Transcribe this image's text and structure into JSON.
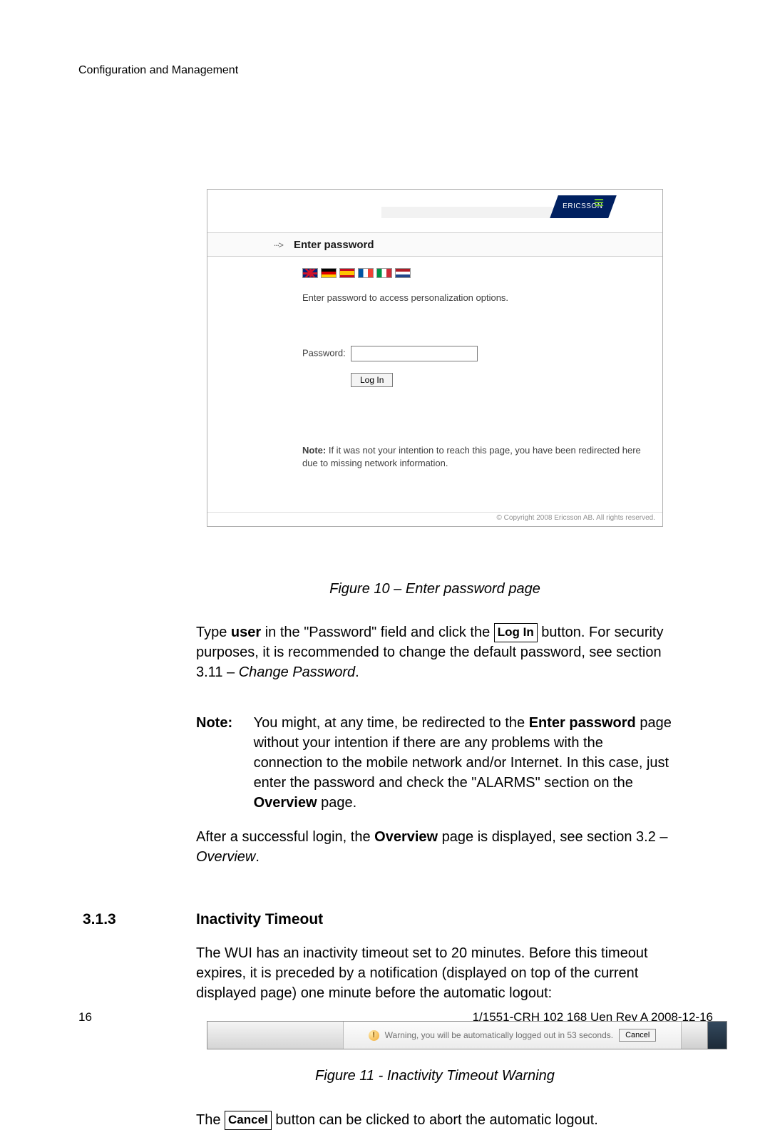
{
  "header": {
    "title": "Configuration and Management"
  },
  "figure10": {
    "logo_text": "ERICSSON",
    "breadcrumb_arrow": "···>",
    "title": "Enter password",
    "instruction": "Enter password to access personalization options.",
    "password_label": "Password:",
    "login_button": "Log In",
    "note_label": "Note:",
    "note_text": "If it was not your intention to reach this page, you have been redirected here due to missing network information.",
    "copyright": "© Copyright 2008 Ericsson AB. All rights reserved."
  },
  "caption10": "Figure 10 – Enter password page",
  "para1": {
    "pre": "Type ",
    "user": "user",
    "mid1": " in the \"Password\" field and click the ",
    "btn": "Log In",
    "post1": " button. For security purposes, it is recommended to change the default password, see section 3.11 – ",
    "link": "Change Password",
    "post2": "."
  },
  "note": {
    "label": "Note:",
    "pre": "You might, at any time, be redirected to the ",
    "b1": "Enter password",
    "mid": " page without your intention if there are any problems with the connection to the mobile network and/or Internet. In this case, just enter the password and check the \"ALARMS\" section on the ",
    "b2": "Overview",
    "post": " page."
  },
  "para2": {
    "pre": "After a successful login, the ",
    "b": "Overview",
    "mid": " page is displayed, see section 3.2 – ",
    "link": "Overview",
    "post": "."
  },
  "section": {
    "num": "3.1.3",
    "title": "Inactivity Timeout"
  },
  "para3": "The WUI has an inactivity timeout set to 20 minutes. Before this timeout expires, it is preceded by a notification (displayed on top of the current displayed page) one minute before the automatic logout:",
  "figure11": {
    "warn_glyph": "!",
    "text": "Warning, you will be automatically logged out in 53 seconds.",
    "cancel": "Cancel"
  },
  "caption11": "Figure 11 - Inactivity Timeout Warning",
  "para4": {
    "pre": "The ",
    "btn": "Cancel",
    "post": " button can be clicked to abort the automatic logout."
  },
  "footer": {
    "page": "16",
    "docid": "1/1551-CRH 102 168 Uen Rev A  2008-12-16"
  }
}
